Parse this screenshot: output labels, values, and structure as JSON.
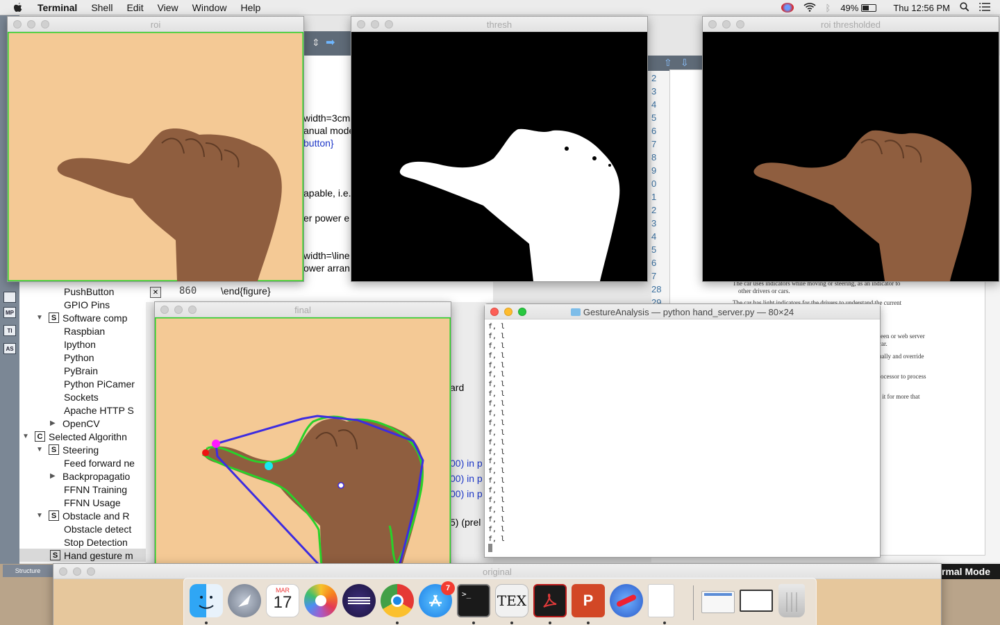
{
  "menubar": {
    "items": [
      "Terminal",
      "Shell",
      "Edit",
      "View",
      "Window",
      "Help"
    ],
    "battery": "49%",
    "clock": "Thu 12:56 PM"
  },
  "gutter_buttons": [
    "MP",
    "TI",
    "AS"
  ],
  "tree": {
    "items": [
      {
        "label": "PushButton",
        "indent": 3,
        "icon": "",
        "toggle": ""
      },
      {
        "label": "GPIO Pins",
        "indent": 3,
        "icon": "",
        "toggle": ""
      },
      {
        "label": "Software comp",
        "indent": 2,
        "icon": "S",
        "toggle": "open"
      },
      {
        "label": "Raspbian",
        "indent": 3,
        "icon": "",
        "toggle": ""
      },
      {
        "label": "Ipython",
        "indent": 3,
        "icon": "",
        "toggle": ""
      },
      {
        "label": "Python",
        "indent": 3,
        "icon": "",
        "toggle": ""
      },
      {
        "label": "PyBrain",
        "indent": 3,
        "icon": "",
        "toggle": ""
      },
      {
        "label": "Python PiCamer",
        "indent": 3,
        "icon": "",
        "toggle": ""
      },
      {
        "label": "Sockets",
        "indent": 3,
        "icon": "",
        "toggle": ""
      },
      {
        "label": "Apache HTTP S",
        "indent": 3,
        "icon": "",
        "toggle": ""
      },
      {
        "label": "OpenCV",
        "indent": 3,
        "icon": "",
        "toggle": "closed"
      },
      {
        "label": "Selected Algorithn",
        "indent": 1,
        "icon": "C",
        "toggle": "open"
      },
      {
        "label": "Steering",
        "indent": 2,
        "icon": "S",
        "toggle": "open"
      },
      {
        "label": "Feed forward ne",
        "indent": 3,
        "icon": "",
        "toggle": ""
      },
      {
        "label": "Backpropagatio",
        "indent": 3,
        "icon": "",
        "toggle": "closed"
      },
      {
        "label": "FFNN Training",
        "indent": 3,
        "icon": "",
        "toggle": ""
      },
      {
        "label": "FFNN Usage",
        "indent": 3,
        "icon": "",
        "toggle": ""
      },
      {
        "label": "Obstacle and R",
        "indent": 2,
        "icon": "S",
        "toggle": "open"
      },
      {
        "label": "Obstacle detect",
        "indent": 3,
        "icon": "",
        "toggle": ""
      },
      {
        "label": "Stop Detection",
        "indent": 3,
        "icon": "",
        "toggle": ""
      },
      {
        "label": "Hand gesture m",
        "indent": 2,
        "icon": "S",
        "toggle": "",
        "selected": true
      }
    ],
    "structure_tab": "Structure"
  },
  "editor": {
    "line_number": "860",
    "end_figure": "\\end{figure}",
    "frags": [
      "width=3cm",
      "anual mode",
      "button}",
      "apable, i.e.",
      "er power e",
      "width=\\line",
      "ower arran"
    ],
    "lower_frags": [
      "ard",
      "00) in p",
      "00) in p",
      "00) in p",
      "5) (prel"
    ]
  },
  "right_pane": {
    "line_numbers": [
      "2",
      "3",
      "4",
      "5",
      "6",
      "7",
      "8",
      "9",
      "0",
      "1",
      "2",
      "3",
      "4",
      "5",
      "6",
      "7",
      "28",
      "29"
    ],
    "doc_lines": [
      "The car uses indicators while moving or steering, as an indicator to",
      "other drivers or cars.",
      "The car has light indicators for the drivers to understand the current",
      "reen or web server",
      "car.",
      "ually and override",
      "rocessor to process",
      "r it for more that"
    ],
    "normal_mode": "rmal Mode"
  },
  "windows": {
    "roi": "roi",
    "thresh": "thresh",
    "roi_thresholded": "roi thresholded",
    "final": "final",
    "original": "original",
    "terminal_title": "GestureAnalysis — python hand_server.py — 80×24"
  },
  "terminal": {
    "lines": [
      "f, l",
      "f, l",
      "f, l",
      "f, l",
      "f, l",
      "f, l",
      "f, l",
      "f, l",
      "f, l",
      "f, l",
      "f, l",
      "f, l",
      "f, l",
      "f, l",
      "f, l",
      "f, l",
      "f, l",
      "f, l",
      "f, l",
      "f, l",
      "f, l",
      "f, l",
      "f, l"
    ]
  },
  "dock": {
    "calendar_month": "MAR",
    "calendar_day": "17",
    "appstore_badge": "7",
    "terminal_glyph": ">_",
    "tex_label": "TEX",
    "items": [
      "finder-icon",
      "launchpad-icon",
      "calendar-icon",
      "photos-icon",
      "eclipse-icon",
      "chrome-icon",
      "app-store-icon",
      "terminal-icon",
      "texshop-icon",
      "acrobat-icon",
      "powerpoint-icon",
      "pdfsam-icon",
      "document-icon",
      "window-thumbnail-1",
      "window-thumbnail-2",
      "trash-icon"
    ]
  },
  "colors": {
    "skin_bg": "#f4c995",
    "hand": "#8a5a3c",
    "contour": "#28d22a",
    "hull": "#3d2ce0",
    "fingertip_magenta": "#ff18ff",
    "defect_cyan": "#18e8f0",
    "start_red": "#ee1111"
  }
}
